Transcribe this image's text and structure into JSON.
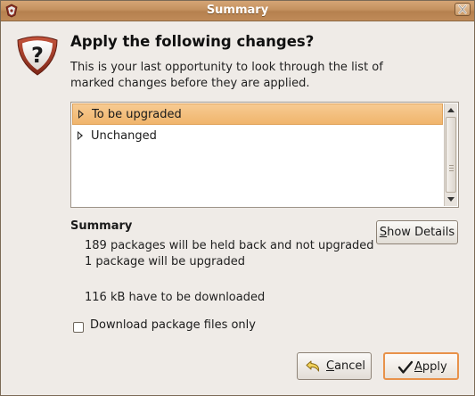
{
  "window": {
    "title": "Summary",
    "close_icon": "close-icon"
  },
  "header": {
    "icon": "question-icon",
    "heading": "Apply the following changes?",
    "description": "This is your last opportunity to look through the list of marked changes before they are applied."
  },
  "changes_list": {
    "items": [
      {
        "label": "To be upgraded",
        "selected": true
      },
      {
        "label": "Unchanged",
        "selected": false
      }
    ]
  },
  "summary": {
    "title": "Summary",
    "lines": [
      "189 packages will be held back and not upgraded",
      "1 package will be upgraded",
      "116 kB have to be downloaded"
    ],
    "show_details_label": "Show Details"
  },
  "options": {
    "download_only_label": "Download package files only",
    "download_only_checked": false
  },
  "buttons": {
    "cancel_label": "Cancel",
    "cancel_icon": "undo-arrow-icon",
    "apply_label": "Apply",
    "apply_icon": "checkmark-icon"
  },
  "colors": {
    "titlebar": "#c4915f",
    "selection": "#f0b56c",
    "default_button_border": "#e8924a",
    "dialog_background": "#efebe7"
  }
}
